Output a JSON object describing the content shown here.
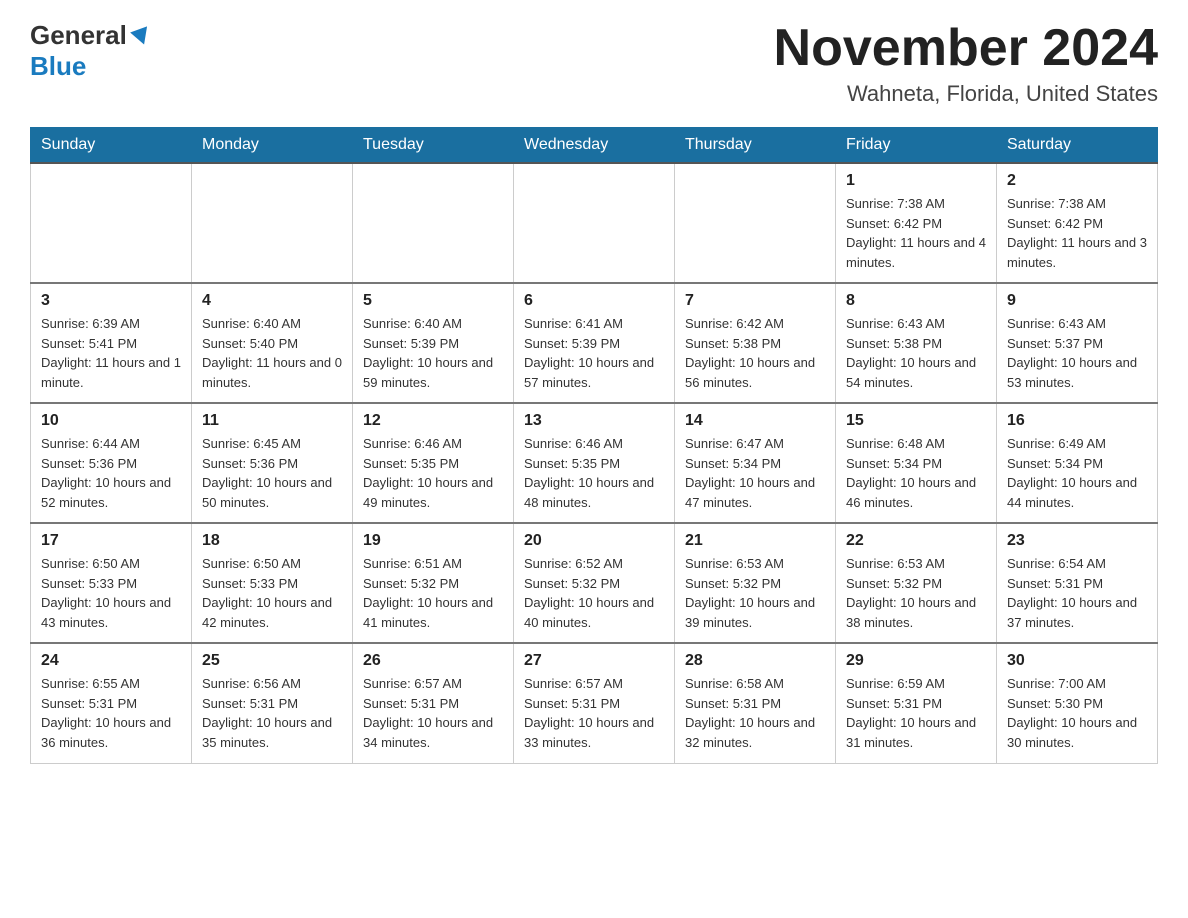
{
  "header": {
    "logo_general": "General",
    "logo_blue": "Blue",
    "month_title": "November 2024",
    "location": "Wahneta, Florida, United States"
  },
  "days_of_week": [
    "Sunday",
    "Monday",
    "Tuesday",
    "Wednesday",
    "Thursday",
    "Friday",
    "Saturday"
  ],
  "weeks": [
    {
      "days": [
        {
          "num": "",
          "info": "",
          "empty": true
        },
        {
          "num": "",
          "info": "",
          "empty": true
        },
        {
          "num": "",
          "info": "",
          "empty": true
        },
        {
          "num": "",
          "info": "",
          "empty": true
        },
        {
          "num": "",
          "info": "",
          "empty": true
        },
        {
          "num": "1",
          "info": "Sunrise: 7:38 AM\nSunset: 6:42 PM\nDaylight: 11 hours and 4 minutes.",
          "empty": false
        },
        {
          "num": "2",
          "info": "Sunrise: 7:38 AM\nSunset: 6:42 PM\nDaylight: 11 hours and 3 minutes.",
          "empty": false
        }
      ]
    },
    {
      "days": [
        {
          "num": "3",
          "info": "Sunrise: 6:39 AM\nSunset: 5:41 PM\nDaylight: 11 hours and 1 minute.",
          "empty": false
        },
        {
          "num": "4",
          "info": "Sunrise: 6:40 AM\nSunset: 5:40 PM\nDaylight: 11 hours and 0 minutes.",
          "empty": false
        },
        {
          "num": "5",
          "info": "Sunrise: 6:40 AM\nSunset: 5:39 PM\nDaylight: 10 hours and 59 minutes.",
          "empty": false
        },
        {
          "num": "6",
          "info": "Sunrise: 6:41 AM\nSunset: 5:39 PM\nDaylight: 10 hours and 57 minutes.",
          "empty": false
        },
        {
          "num": "7",
          "info": "Sunrise: 6:42 AM\nSunset: 5:38 PM\nDaylight: 10 hours and 56 minutes.",
          "empty": false
        },
        {
          "num": "8",
          "info": "Sunrise: 6:43 AM\nSunset: 5:38 PM\nDaylight: 10 hours and 54 minutes.",
          "empty": false
        },
        {
          "num": "9",
          "info": "Sunrise: 6:43 AM\nSunset: 5:37 PM\nDaylight: 10 hours and 53 minutes.",
          "empty": false
        }
      ]
    },
    {
      "days": [
        {
          "num": "10",
          "info": "Sunrise: 6:44 AM\nSunset: 5:36 PM\nDaylight: 10 hours and 52 minutes.",
          "empty": false
        },
        {
          "num": "11",
          "info": "Sunrise: 6:45 AM\nSunset: 5:36 PM\nDaylight: 10 hours and 50 minutes.",
          "empty": false
        },
        {
          "num": "12",
          "info": "Sunrise: 6:46 AM\nSunset: 5:35 PM\nDaylight: 10 hours and 49 minutes.",
          "empty": false
        },
        {
          "num": "13",
          "info": "Sunrise: 6:46 AM\nSunset: 5:35 PM\nDaylight: 10 hours and 48 minutes.",
          "empty": false
        },
        {
          "num": "14",
          "info": "Sunrise: 6:47 AM\nSunset: 5:34 PM\nDaylight: 10 hours and 47 minutes.",
          "empty": false
        },
        {
          "num": "15",
          "info": "Sunrise: 6:48 AM\nSunset: 5:34 PM\nDaylight: 10 hours and 46 minutes.",
          "empty": false
        },
        {
          "num": "16",
          "info": "Sunrise: 6:49 AM\nSunset: 5:34 PM\nDaylight: 10 hours and 44 minutes.",
          "empty": false
        }
      ]
    },
    {
      "days": [
        {
          "num": "17",
          "info": "Sunrise: 6:50 AM\nSunset: 5:33 PM\nDaylight: 10 hours and 43 minutes.",
          "empty": false
        },
        {
          "num": "18",
          "info": "Sunrise: 6:50 AM\nSunset: 5:33 PM\nDaylight: 10 hours and 42 minutes.",
          "empty": false
        },
        {
          "num": "19",
          "info": "Sunrise: 6:51 AM\nSunset: 5:32 PM\nDaylight: 10 hours and 41 minutes.",
          "empty": false
        },
        {
          "num": "20",
          "info": "Sunrise: 6:52 AM\nSunset: 5:32 PM\nDaylight: 10 hours and 40 minutes.",
          "empty": false
        },
        {
          "num": "21",
          "info": "Sunrise: 6:53 AM\nSunset: 5:32 PM\nDaylight: 10 hours and 39 minutes.",
          "empty": false
        },
        {
          "num": "22",
          "info": "Sunrise: 6:53 AM\nSunset: 5:32 PM\nDaylight: 10 hours and 38 minutes.",
          "empty": false
        },
        {
          "num": "23",
          "info": "Sunrise: 6:54 AM\nSunset: 5:31 PM\nDaylight: 10 hours and 37 minutes.",
          "empty": false
        }
      ]
    },
    {
      "days": [
        {
          "num": "24",
          "info": "Sunrise: 6:55 AM\nSunset: 5:31 PM\nDaylight: 10 hours and 36 minutes.",
          "empty": false
        },
        {
          "num": "25",
          "info": "Sunrise: 6:56 AM\nSunset: 5:31 PM\nDaylight: 10 hours and 35 minutes.",
          "empty": false
        },
        {
          "num": "26",
          "info": "Sunrise: 6:57 AM\nSunset: 5:31 PM\nDaylight: 10 hours and 34 minutes.",
          "empty": false
        },
        {
          "num": "27",
          "info": "Sunrise: 6:57 AM\nSunset: 5:31 PM\nDaylight: 10 hours and 33 minutes.",
          "empty": false
        },
        {
          "num": "28",
          "info": "Sunrise: 6:58 AM\nSunset: 5:31 PM\nDaylight: 10 hours and 32 minutes.",
          "empty": false
        },
        {
          "num": "29",
          "info": "Sunrise: 6:59 AM\nSunset: 5:31 PM\nDaylight: 10 hours and 31 minutes.",
          "empty": false
        },
        {
          "num": "30",
          "info": "Sunrise: 7:00 AM\nSunset: 5:30 PM\nDaylight: 10 hours and 30 minutes.",
          "empty": false
        }
      ]
    }
  ]
}
